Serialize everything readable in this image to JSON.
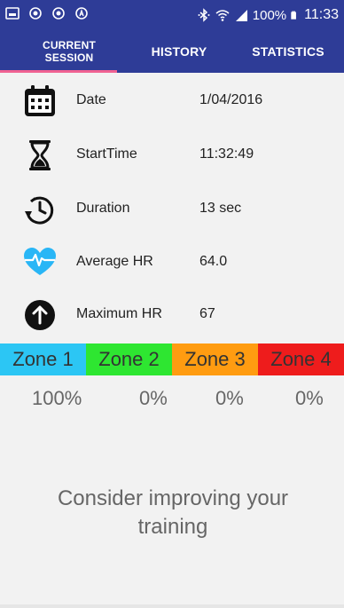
{
  "status_bar": {
    "battery_text": "100%",
    "time": "11:33",
    "left_icons": [
      "gallery-icon",
      "record-icon",
      "record-icon",
      "fitness-icon"
    ],
    "right_icons": [
      "bluetooth-icon",
      "wifi-icon",
      "signal-icon",
      "battery-icon"
    ]
  },
  "tabs": {
    "current_line1": "CURRENT",
    "current_line2": "SESSION",
    "history": "HISTORY",
    "statistics": "STATISTICS",
    "active": "current"
  },
  "session": {
    "date_label": "Date",
    "date_value": "1/04/2016",
    "start_label": "StartTime",
    "start_value": "11:32:49",
    "duration_label": "Duration",
    "duration_value": "13 sec",
    "avg_label": "Average HR",
    "avg_value": "64.0",
    "max_label": "Maximum HR",
    "max_value": "67"
  },
  "zones": {
    "z1_label": "Zone 1",
    "z2_label": "Zone 2",
    "z3_label": "Zone 3",
    "z4_label": "Zone 4",
    "z1_pct": "100%",
    "z2_pct": "0%",
    "z3_pct": "0%",
    "z4_pct": "0%"
  },
  "message": "Consider improving your training",
  "colors": {
    "app_bar": "#2e3c97",
    "tab_indicator": "#f06292",
    "zone1": "#2cc6f4",
    "zone2": "#2ee631",
    "zone3": "#ff9c11",
    "zone4": "#ee1c1c"
  }
}
